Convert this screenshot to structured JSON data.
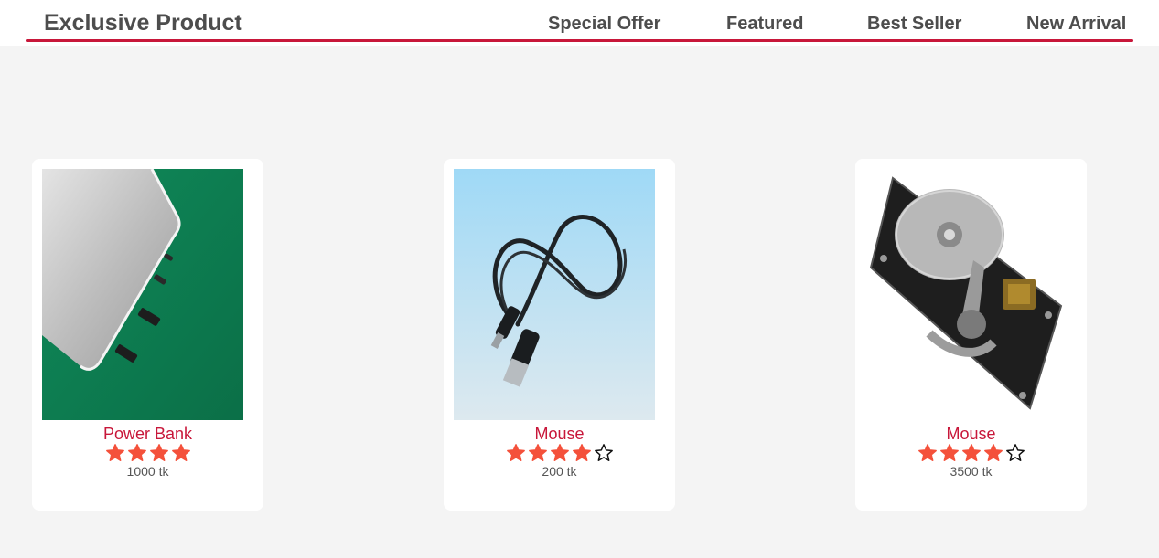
{
  "header": {
    "brand": "Exclusive Product",
    "nav": [
      "Special Offer",
      "Featured",
      "Best Seller",
      "New Arrival"
    ]
  },
  "colors": {
    "accent": "#c8173a",
    "star_filled": "#f4513b",
    "star_empty": "#ffffff",
    "page_bg": "#f4f4f4"
  },
  "products": [
    {
      "name": "Power Bank",
      "rating": 4,
      "stars_shown": 4,
      "price": "1000 tk",
      "image": "power-bank-image"
    },
    {
      "name": "Mouse",
      "rating": 4,
      "stars_shown": 5,
      "price": "200 tk",
      "image": "usb-cable-image"
    },
    {
      "name": "Mouse",
      "rating": 4,
      "stars_shown": 5,
      "price": "3500 tk",
      "image": "hard-drive-image"
    }
  ]
}
